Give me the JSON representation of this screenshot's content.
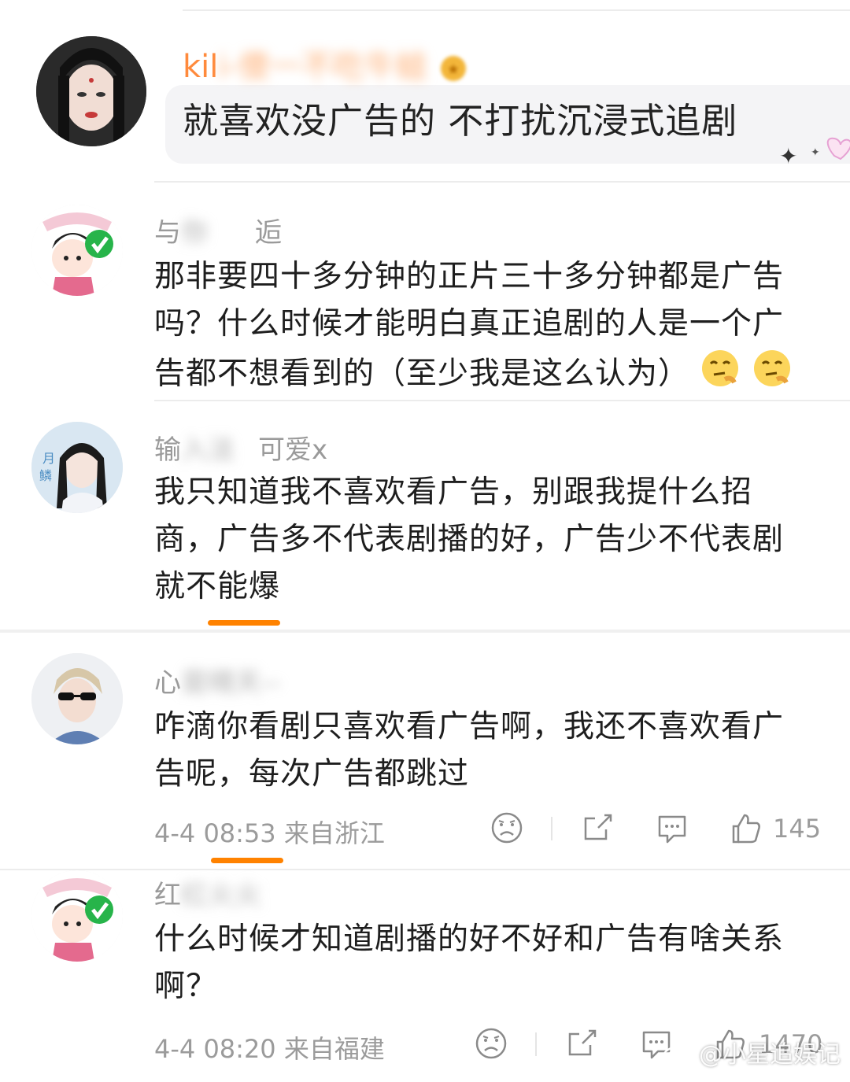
{
  "comments": [
    {
      "name_visible": "kil",
      "name_blurred": "i-傻一不吃牛蛙",
      "text": "就喜欢没广告的 不打扰沉浸式追剧"
    },
    {
      "name_visible": "与",
      "name_blurred": "你",
      "name_tail": "逅",
      "text": "那非要四十多分钟的正片三十多分钟都是广告吗？什么时候才能明白真正追剧的人是一个广告都不想看到的（至少我是这么认为）"
    },
    {
      "name_visible": "输",
      "name_blurred": "入法",
      "name_tail": "可爱x",
      "text": "我只知道我不喜欢看广告，别跟我提什么招商，广告多不代表剧播的好，广告少不代表剧就不能爆"
    },
    {
      "name_visible": "心",
      "name_blurred": "是晴天--",
      "text": "咋滴你看剧只喜欢看广告啊，我还不喜欢看广告呢，每次广告都跳过",
      "time": "4-4 08:53 来自浙江",
      "likes": "145"
    },
    {
      "name_visible": "红",
      "name_blurred": "红火火",
      "name_tail": "",
      "text": "什么时候才知道剧播的好不好和广告有啥关系啊？",
      "time": "4-4 08:20 来自福建",
      "likes": "1470"
    }
  ],
  "watermark": "@小星追娱记",
  "colors": {
    "accent": "#ff8200",
    "meta": "#9b9b9b"
  },
  "icons": [
    "sad-face-icon",
    "share-icon",
    "comment-icon",
    "thumbs-up-icon"
  ]
}
